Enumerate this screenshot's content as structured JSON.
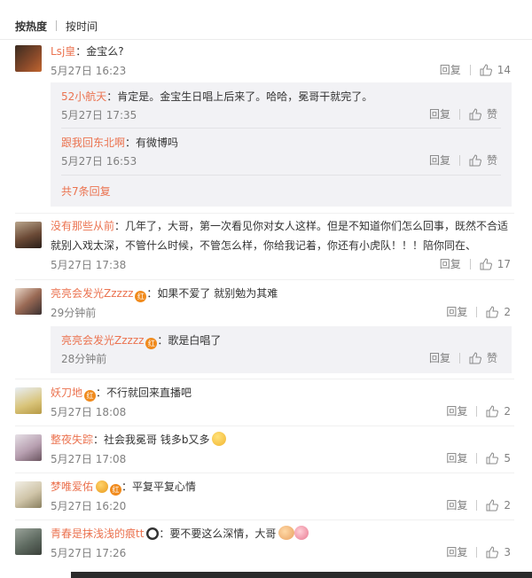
{
  "tabs": {
    "hot": "按热度",
    "time": "按时间"
  },
  "actions": {
    "reply": "回复",
    "like_label": "赞"
  },
  "comments": [
    {
      "user": "Lsj皇",
      "text": "：金宝么?",
      "time": "5月27日 16:23",
      "likes": "14",
      "replies": [
        {
          "user": "52小航天",
          "text": "：肯定是。金宝生日唱上后来了。哈哈，冕哥干就完了。",
          "time": "5月27日 17:35"
        },
        {
          "user": "跟我回东北啊",
          "text": "：有微博吗",
          "time": "5月27日 16:53"
        }
      ],
      "more": "共7条回复"
    },
    {
      "user": "没有那些从前",
      "text": "：几年了，大哥，第一次看见你对女人这样。但是不知道你们怎么回事，既然不合适",
      "text2": "就别入戏太深，不管什么时候，不管怎么样，你给我记着，你还有小虎队！！！陪你同在、",
      "time": "5月27日 17:38",
      "likes": "17"
    },
    {
      "user": "亮亮会发光Zzzzz",
      "badge": "红",
      "text": "：如果不爱了 就别勉为其难",
      "time": "29分钟前",
      "likes": "2",
      "replies": [
        {
          "user": "亮亮会发光Zzzzz",
          "badge": "红",
          "text": "：歌是白唱了",
          "time": "28分钟前"
        }
      ]
    },
    {
      "user": "妖刀地",
      "badge": "红",
      "text": "：不行就回来直播吧",
      "time": "5月27日 18:08",
      "likes": "2"
    },
    {
      "user": "整夜失踪",
      "text": "：社会我冕哥 钱多b又多",
      "time": "5月27日 17:08",
      "likes": "5"
    },
    {
      "user": "梦唯爱佑",
      "badge": "红",
      "text": "：平复平复心情",
      "time": "5月27日 16:20",
      "likes": "2"
    },
    {
      "user": "青春是抹浅浅的痕tt",
      "text": "：要不要这么深情，大哥",
      "time": "5月27日 17:26",
      "likes": "3"
    }
  ]
}
